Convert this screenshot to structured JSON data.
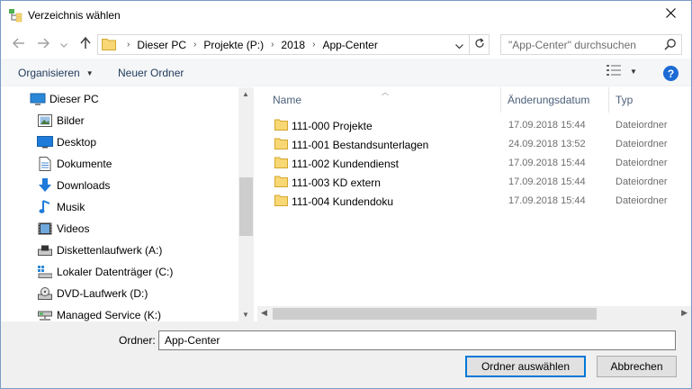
{
  "window": {
    "title": "Verzeichnis wählen"
  },
  "nav": {
    "breadcrumbs": [
      "Dieser PC",
      "Projekte (P:)",
      "2018",
      "App-Center"
    ],
    "search_placeholder": "\"App-Center\" durchsuchen"
  },
  "toolbar": {
    "organize_label": "Organisieren",
    "new_folder_label": "Neuer Ordner",
    "help_label": "?"
  },
  "sidebar": {
    "items": [
      {
        "label": "Dieser PC",
        "icon": "computer-icon"
      },
      {
        "label": "Bilder",
        "icon": "pictures-icon"
      },
      {
        "label": "Desktop",
        "icon": "desktop-icon"
      },
      {
        "label": "Dokumente",
        "icon": "documents-icon"
      },
      {
        "label": "Downloads",
        "icon": "downloads-icon"
      },
      {
        "label": "Musik",
        "icon": "music-icon"
      },
      {
        "label": "Videos",
        "icon": "videos-icon"
      },
      {
        "label": "Diskettenlaufwerk (A:)",
        "icon": "floppy-drive-icon"
      },
      {
        "label": "Lokaler Datenträger (C:)",
        "icon": "local-disk-icon"
      },
      {
        "label": "DVD-Laufwerk (D:)",
        "icon": "dvd-drive-icon"
      },
      {
        "label": "Managed Service (K:)",
        "icon": "network-drive-icon"
      }
    ]
  },
  "list": {
    "columns": {
      "name": "Name",
      "date": "Änderungsdatum",
      "type": "Typ"
    },
    "rows": [
      {
        "name": "111-000 Projekte",
        "date": "17.09.2018 15:44",
        "type": "Dateiordner"
      },
      {
        "name": "111-001 Bestandsunterlagen",
        "date": "24.09.2018 13:52",
        "type": "Dateiordner"
      },
      {
        "name": "111-002 Kundendienst",
        "date": "17.09.2018 15:44",
        "type": "Dateiordner"
      },
      {
        "name": "111-003 KD extern",
        "date": "17.09.2018 15:44",
        "type": "Dateiordner"
      },
      {
        "name": "111-004 Kundendoku",
        "date": "17.09.2018 15:44",
        "type": "Dateiordner"
      }
    ]
  },
  "footer": {
    "folder_label": "Ordner:",
    "folder_value": "App-Center",
    "select_button": "Ordner auswählen",
    "cancel_button": "Abbrechen"
  },
  "colors": {
    "accent": "#0078d7",
    "folder": "#f8d775",
    "help": "#1c6bd4"
  }
}
